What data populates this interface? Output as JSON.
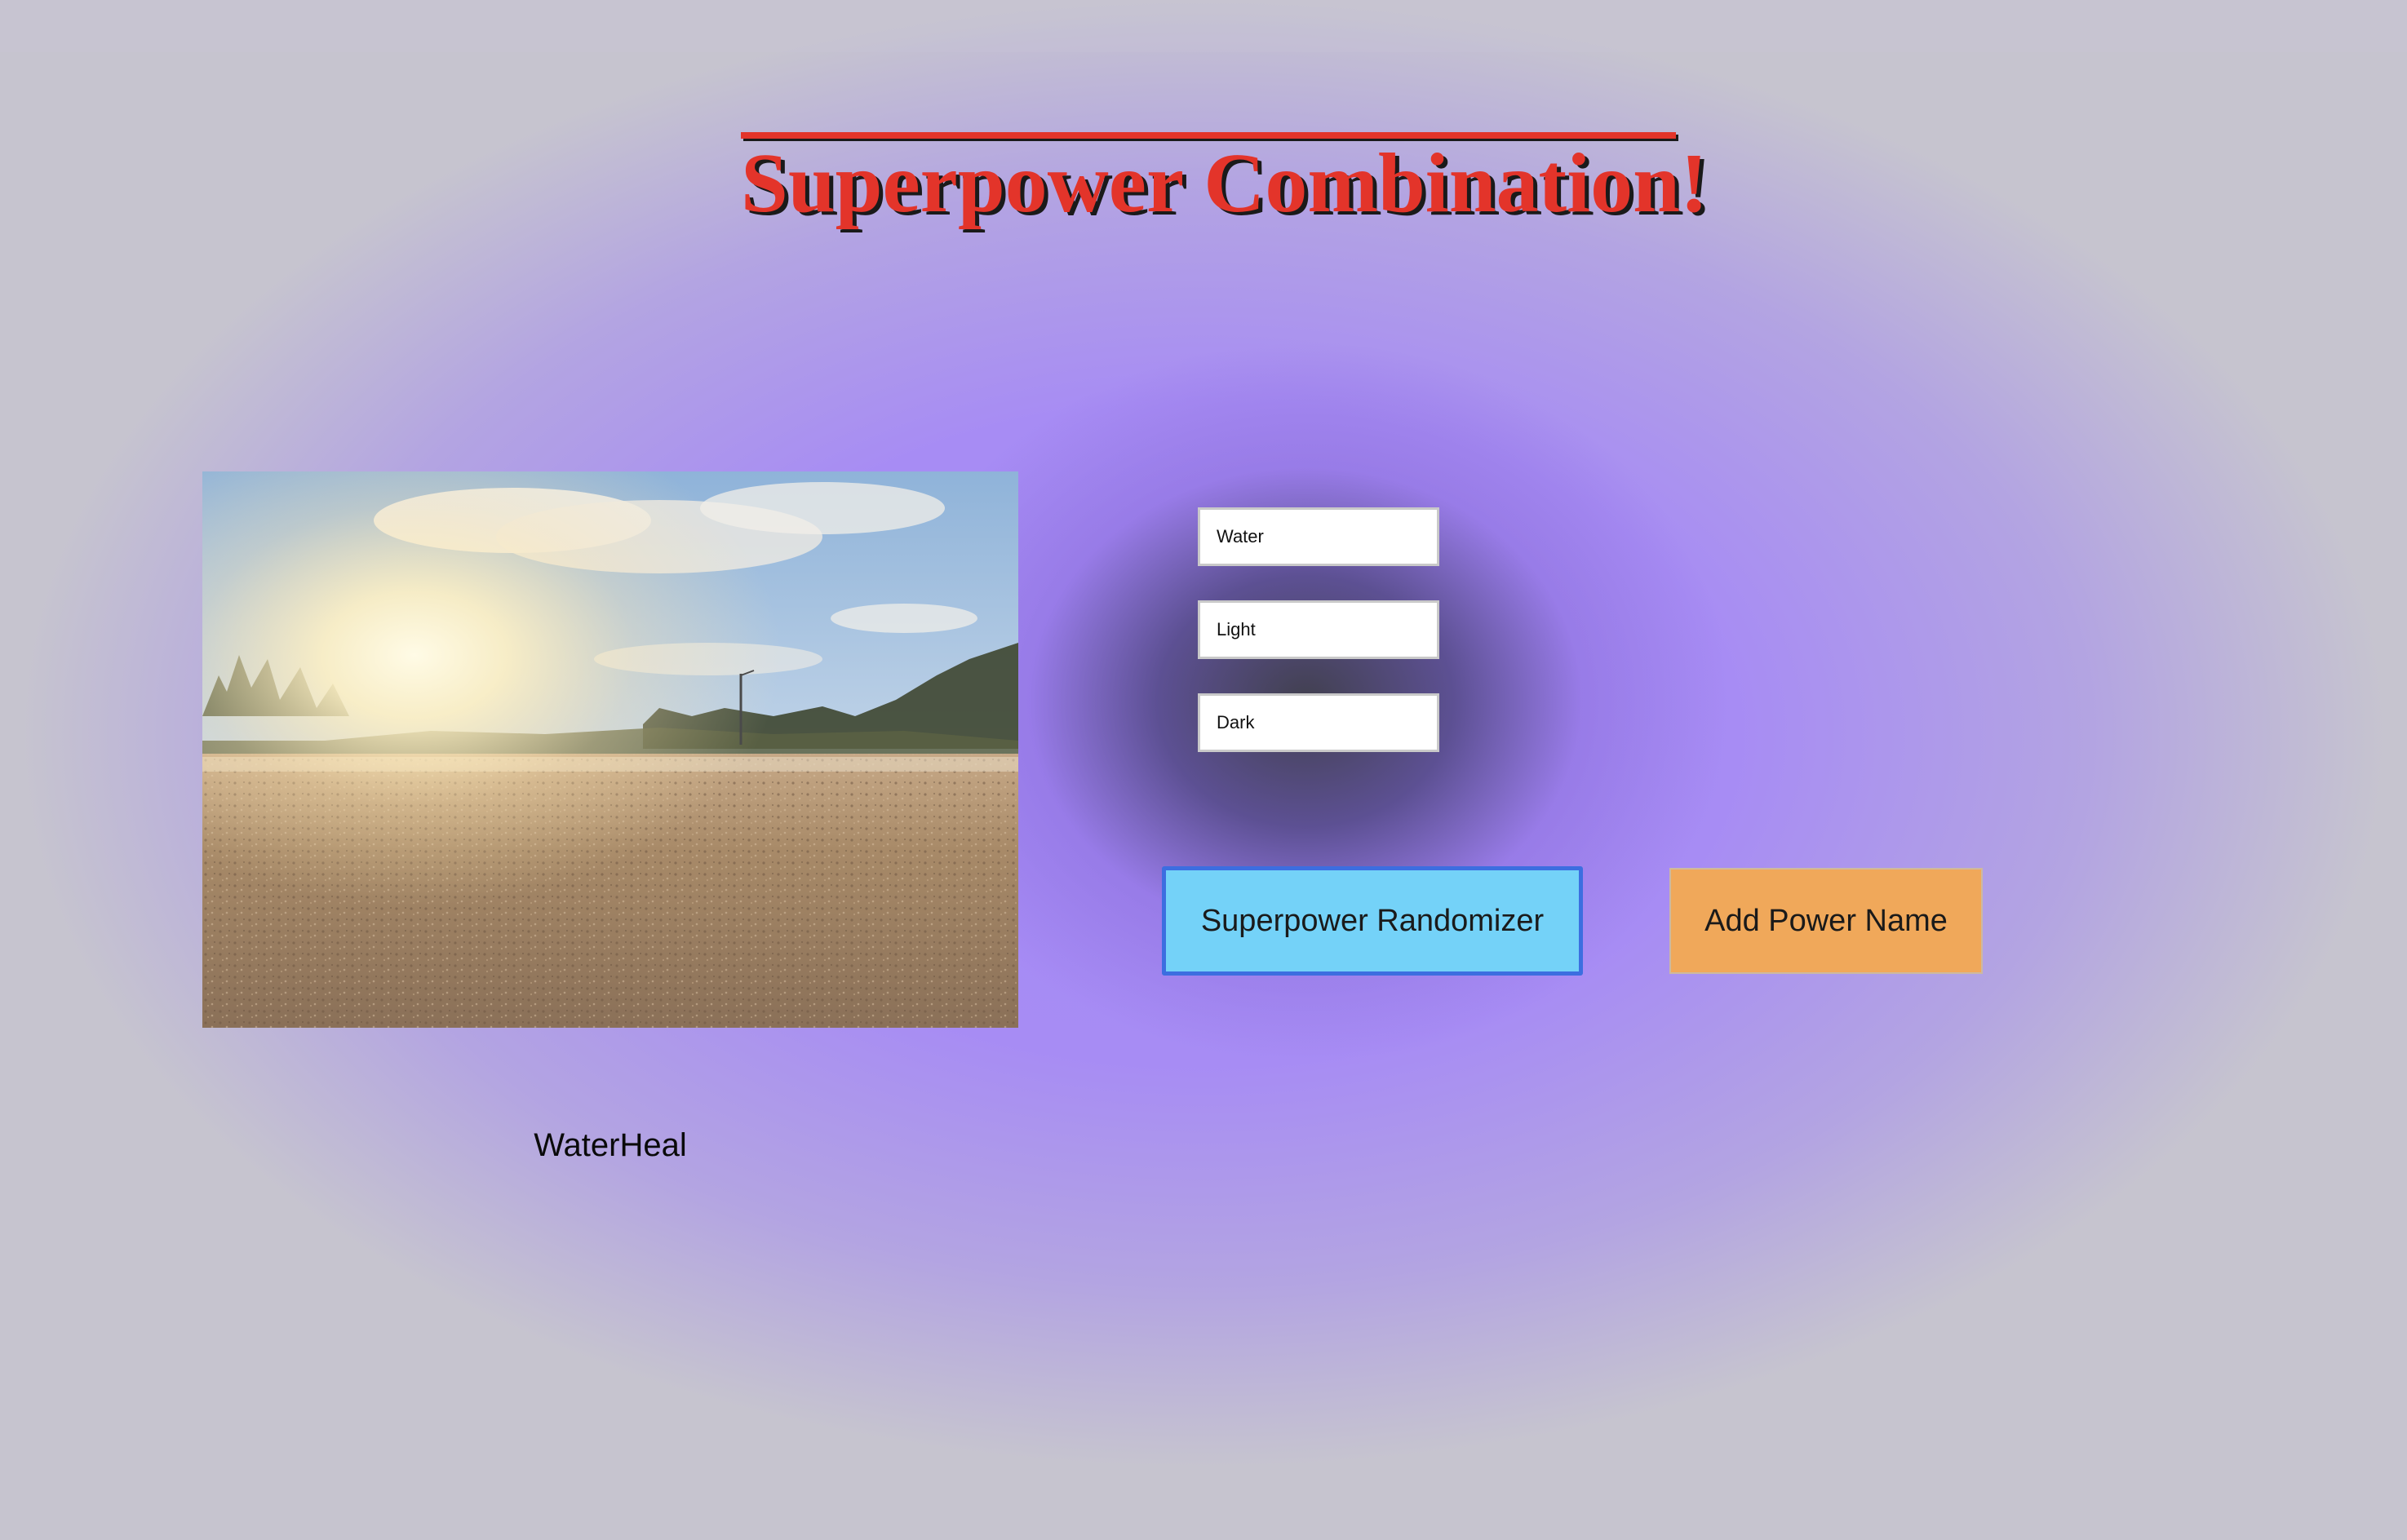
{
  "page": {
    "title": "Superpower Combination!"
  },
  "image": {
    "icon": "landscape-photo",
    "alt_description_shown": false
  },
  "result": {
    "power_name": "WaterHeal"
  },
  "inputs": [
    {
      "value": "Water"
    },
    {
      "value": "Light"
    },
    {
      "value": "Dark"
    }
  ],
  "buttons": {
    "randomize_label": "Superpower Randomizer",
    "add_name_label": "Add Power Name"
  },
  "colors": {
    "title": "#e3342a",
    "title_shadow": "#1a1a1a",
    "background_accent": "#a48af7",
    "randomize_button": "#74d2f8",
    "randomize_border": "#3c6ee0",
    "add_button": "#f0a85a"
  }
}
